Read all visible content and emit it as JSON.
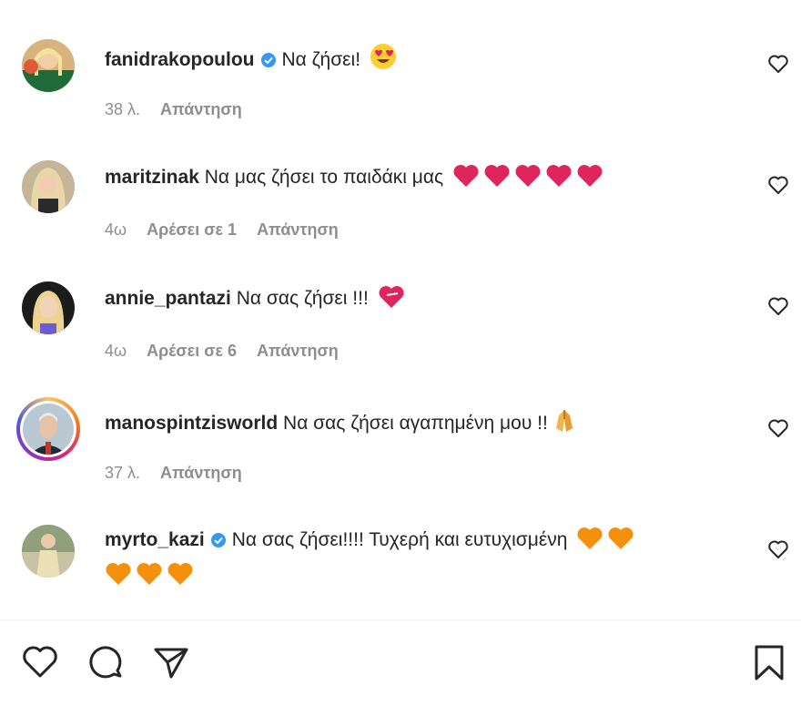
{
  "comments": [
    {
      "username": "fanidrakopoulou",
      "verified": true,
      "text": "Να ζήσει!",
      "emoji": "heart-eyes-emoji",
      "time": "38 λ.",
      "likes": "",
      "reply": "Απάντηση"
    },
    {
      "username": "maritzinak",
      "verified": false,
      "text": "Να μας ζήσει το παιδάκι μας",
      "emoji": "red-heart-emoji x5",
      "time": "4ω",
      "likes": "Αρέσει σε 1",
      "reply": "Απάντηση"
    },
    {
      "username": "annie_pantazi",
      "verified": false,
      "text": "Να σας ζήσει !!!",
      "emoji": "heart-emoji",
      "time": "4ω",
      "likes": "Αρέσει σε 6",
      "reply": "Απάντηση"
    },
    {
      "username": "manospintzisworld",
      "verified": false,
      "text": "Να σας ζήσει αγαπημένη μου !!",
      "emoji": "praying-hands-emoji",
      "time": "37 λ.",
      "likes": "",
      "reply": "Απάντηση"
    },
    {
      "username": "myrto_kazi",
      "verified": true,
      "text": "Να σας ζήσει!!!! Τυχερή και ευτυχισμένη",
      "emoji": "orange-heart-emoji x5",
      "time": "",
      "likes": "",
      "reply": ""
    }
  ],
  "colors": {
    "verified": "#3897f0",
    "meta": "#8e8e8e",
    "red_heart": "#e0245e",
    "orange_heart": "#f4900c"
  },
  "actions": [
    "heart-icon",
    "comment-icon",
    "share-icon",
    "bookmark-icon"
  ]
}
